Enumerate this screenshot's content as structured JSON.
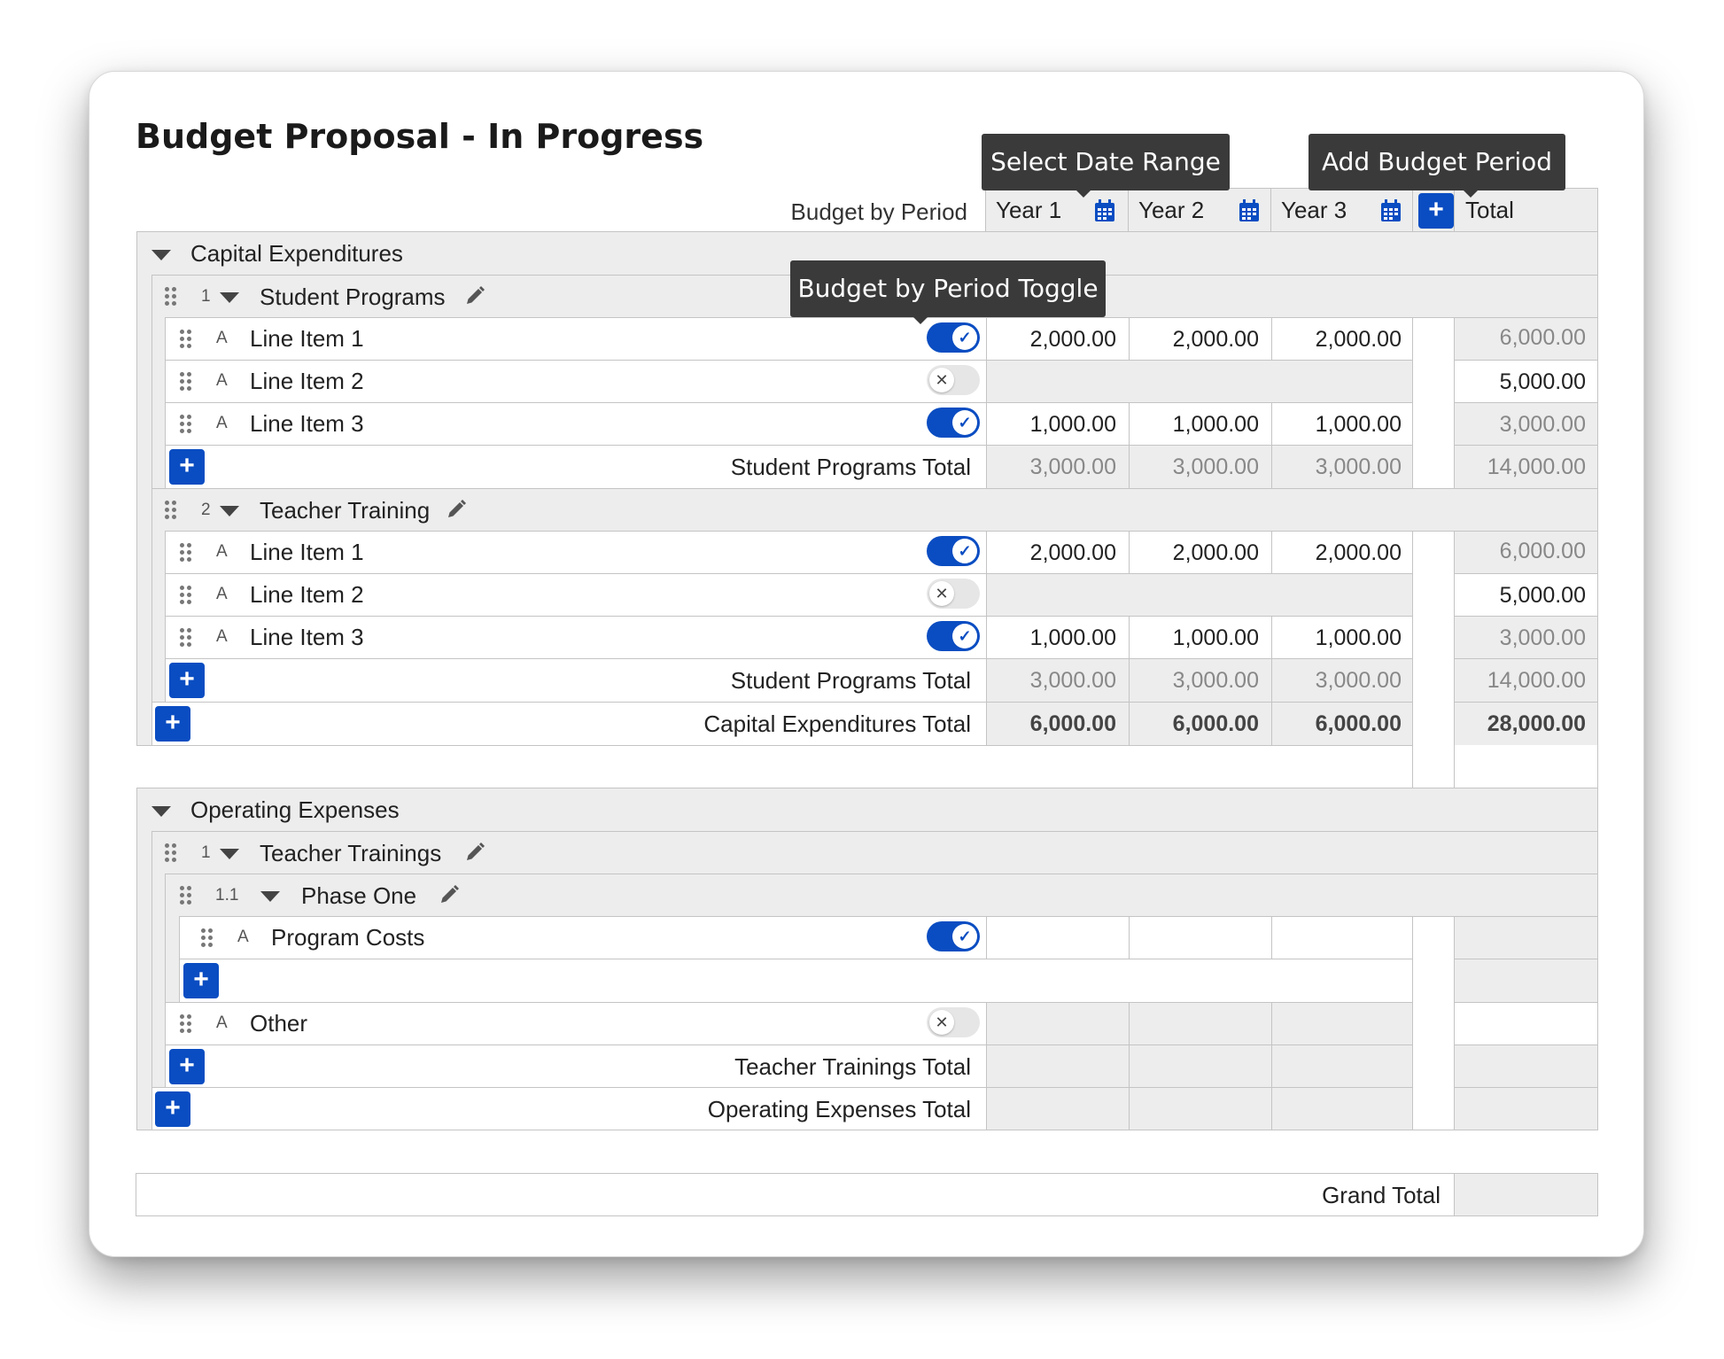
{
  "title": "Budget Proposal - In Progress",
  "header": {
    "budget_by_period_label": "Budget by Period",
    "years": [
      "Year 1",
      "Year 2",
      "Year 3"
    ],
    "total_label": "Total",
    "add_period_symbol": "+"
  },
  "tooltips": {
    "select_date_range": "Select Date Range",
    "add_budget_period": "Add Budget Period",
    "budget_by_period_toggle": "Budget by Period Toggle"
  },
  "capital": {
    "title": "Capital Expenditures",
    "total_label": "Capital Expenditures Total",
    "totals": [
      "6,000.00",
      "6,000.00",
      "6,000.00",
      "28,000.00"
    ],
    "student_programs": {
      "index": "1",
      "title": "Student Programs",
      "items": [
        {
          "type": "A",
          "name": "Line Item 1",
          "toggle": "on",
          "y1": "2,000.00",
          "y2": "2,000.00",
          "y3": "2,000.00",
          "total": "6,000.00"
        },
        {
          "type": "A",
          "name": "Line Item 2",
          "toggle": "off",
          "total": "5,000.00"
        },
        {
          "type": "A",
          "name": "Line Item 3",
          "toggle": "on",
          "y1": "1,000.00",
          "y2": "1,000.00",
          "y3": "1,000.00",
          "total": "3,000.00"
        }
      ],
      "total_label": "Student Programs Total",
      "totals": [
        "3,000.00",
        "3,000.00",
        "3,000.00",
        "14,000.00"
      ]
    },
    "teacher_training": {
      "index": "2",
      "title": "Teacher Training",
      "items": [
        {
          "type": "A",
          "name": "Line Item 1",
          "toggle": "on",
          "y1": "2,000.00",
          "y2": "2,000.00",
          "y3": "2,000.00",
          "total": "6,000.00"
        },
        {
          "type": "A",
          "name": "Line Item 2",
          "toggle": "off",
          "total": "5,000.00"
        },
        {
          "type": "A",
          "name": "Line Item 3",
          "toggle": "on",
          "y1": "1,000.00",
          "y2": "1,000.00",
          "y3": "1,000.00",
          "total": "3,000.00"
        }
      ],
      "total_label": "Student Programs Total",
      "totals": [
        "3,000.00",
        "3,000.00",
        "3,000.00",
        "14,000.00"
      ]
    }
  },
  "operating": {
    "title": "Operating Expenses",
    "total_label": "Operating Expenses Total",
    "teacher_trainings": {
      "index": "1",
      "title": "Teacher Trainings",
      "total_label": "Teacher Trainings Total",
      "phase_one": {
        "index": "1.1",
        "title": "Phase One",
        "items": [
          {
            "type": "A",
            "name": "Program Costs",
            "toggle": "on"
          }
        ]
      },
      "other": {
        "type": "A",
        "name": "Other",
        "toggle": "off"
      }
    }
  },
  "grand_total_label": "Grand Total",
  "icons": {
    "check": "✓",
    "cross": "✕",
    "plus": "+"
  },
  "colors": {
    "accent": "#0a4dc2",
    "tooltip_bg": "#3a3a3a",
    "row_gray": "#ededed"
  }
}
